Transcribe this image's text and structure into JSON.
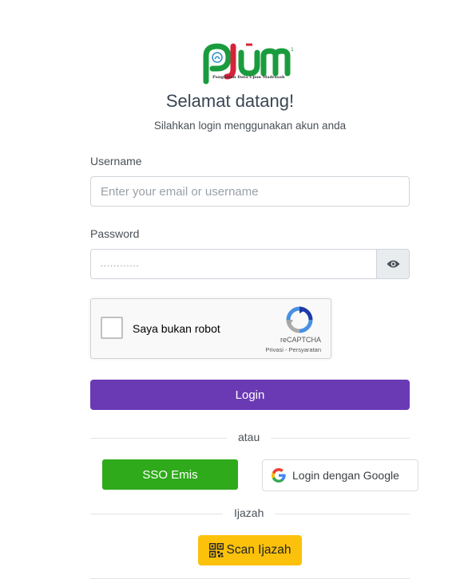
{
  "header": {
    "logo_caption": "Pangkalan Data Ujian Madrasah",
    "title": "Selamat datang!",
    "subtitle": "Silahkan login menggunakan akun anda"
  },
  "form": {
    "username_label": "Username",
    "username_placeholder": "Enter your email or username",
    "password_label": "Password",
    "password_value": "............"
  },
  "captcha": {
    "label": "Saya bukan robot",
    "brand": "reCAPTCHA",
    "links": "Privasi - Persyaratan"
  },
  "buttons": {
    "login": "Login",
    "sso": "SSO Emis",
    "google": "Login dengan Google",
    "scan": "Scan Ijazah"
  },
  "dividers": {
    "or": "atau",
    "ijazah": "Ijazah"
  },
  "colors": {
    "login": "#6a3ab5",
    "sso": "#2eaa1a",
    "scan": "#fcc10b"
  },
  "icons": {
    "password_toggle": "eye-icon",
    "google": "google-g-icon",
    "scan": "qr-code-icon",
    "captcha": "recaptcha-icon"
  }
}
